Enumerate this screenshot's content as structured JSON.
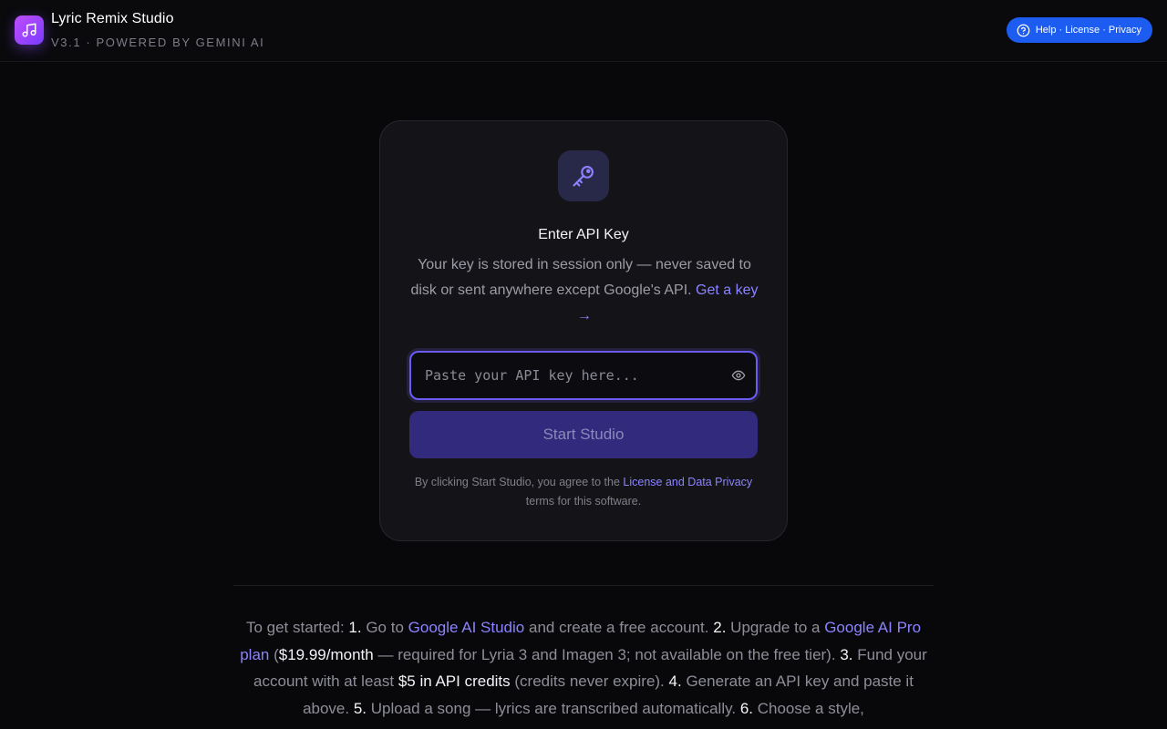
{
  "header": {
    "title": "Lyric Remix Studio",
    "subtitle": "V3.1 · POWERED BY GEMINI AI",
    "logo_icon": "music-note-icon",
    "help_label": "Help · License · Privacy",
    "help_icon": "question-circle-icon"
  },
  "card": {
    "icon": "key-icon",
    "title": "Enter API Key",
    "description": "Your key is stored in session only — never saved to disk or sent anywhere except Google's API.",
    "get_key_link": "Get a key →",
    "input": {
      "placeholder": "Paste your API key here...",
      "value": "",
      "toggle_icon": "eye-icon"
    },
    "start_button": "Start Studio",
    "terms_prefix": "By clicking Start Studio, you agree to the",
    "terms_link": "License and Data Privacy",
    "terms_suffix": "terms for this software."
  },
  "instructions": {
    "intro": "To get started:",
    "step1_num": "1.",
    "step1_a": "Go to",
    "step1_link": "Google AI Studio",
    "step1_b": "and create a free account.",
    "step2_num": "2.",
    "step2_a": "Upgrade to a",
    "step2_link": "Google AI Pro plan",
    "step2_b": "(",
    "step2_price": "$19.99/month",
    "step2_c": "— required for Lyria 3 and Imagen 3; not available on the free tier).",
    "step3_num": "3.",
    "step3_a": "Fund your account with at least",
    "step3_hl": "$5 in API credits",
    "step3_b": "(credits never expire).",
    "step4_num": "4.",
    "step4_a": "Generate an API key and paste it above.",
    "step5_num": "5.",
    "step5_a": "Upload a song — lyrics are transcribed automatically.",
    "step6_num": "6.",
    "step6_a": "Choose a style,"
  },
  "colors": {
    "background": "#08080b",
    "accent": "#8b83ff",
    "help_button": "#1d5cf0",
    "start_button": "#322a7c"
  }
}
